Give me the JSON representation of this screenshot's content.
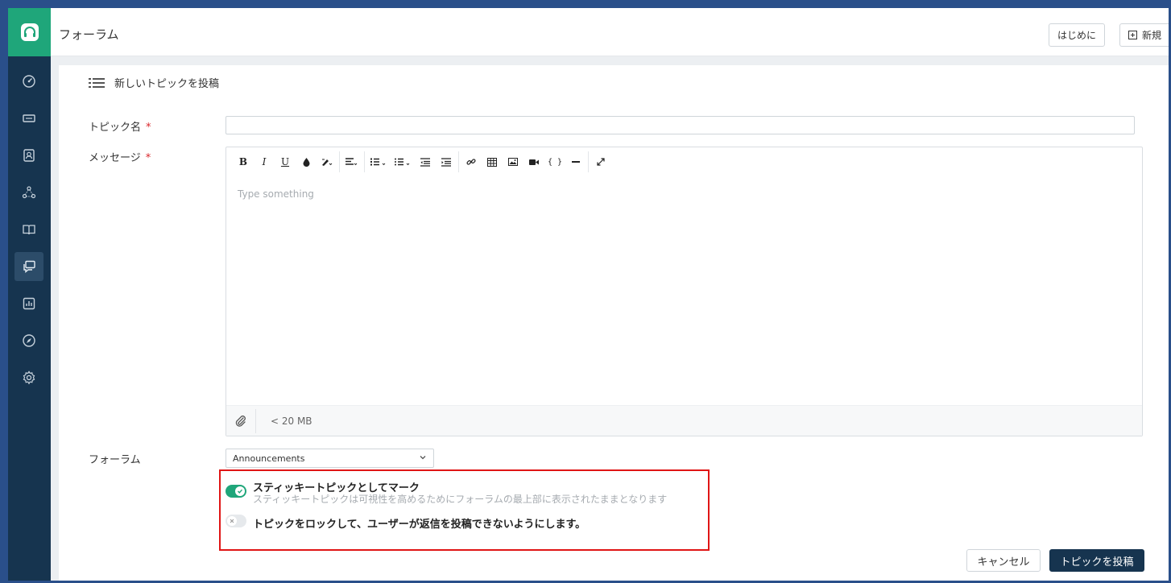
{
  "header": {
    "title": "フォーラム",
    "getting_started_label": "はじめに",
    "new_label": "新規"
  },
  "sidebar": {
    "items": [
      {
        "icon": "dashboard-icon"
      },
      {
        "icon": "ticket-icon"
      },
      {
        "icon": "contact-icon"
      },
      {
        "icon": "group-icon"
      },
      {
        "icon": "knowledge-base-icon"
      },
      {
        "icon": "forum-icon",
        "active": true
      },
      {
        "icon": "reports-icon"
      },
      {
        "icon": "explore-icon"
      },
      {
        "icon": "settings-icon"
      }
    ]
  },
  "form": {
    "heading": "新しいトピックを投稿",
    "topic_name_label": "トピック名",
    "message_label": "メッセージ",
    "required_mark": "*",
    "editor_placeholder": "Type something",
    "attachment_limit": "< 20 MB",
    "forum_label": "フォーラム",
    "forum_selected": "Announcements",
    "sticky_title": "スティッキートピックとしてマーク",
    "sticky_desc": "スティッキートピックは可視性を高めるためにフォーラムの最上部に表示されたままとなります",
    "lock_title": "トピックをロックして、ユーザーが返信を投稿できないようにします。",
    "cancel_label": "キャンセル",
    "submit_label": "トピックを投稿"
  },
  "colors": {
    "sidebar": "#16344f",
    "accent": "#1fa67a",
    "highlight": "#e01515"
  }
}
